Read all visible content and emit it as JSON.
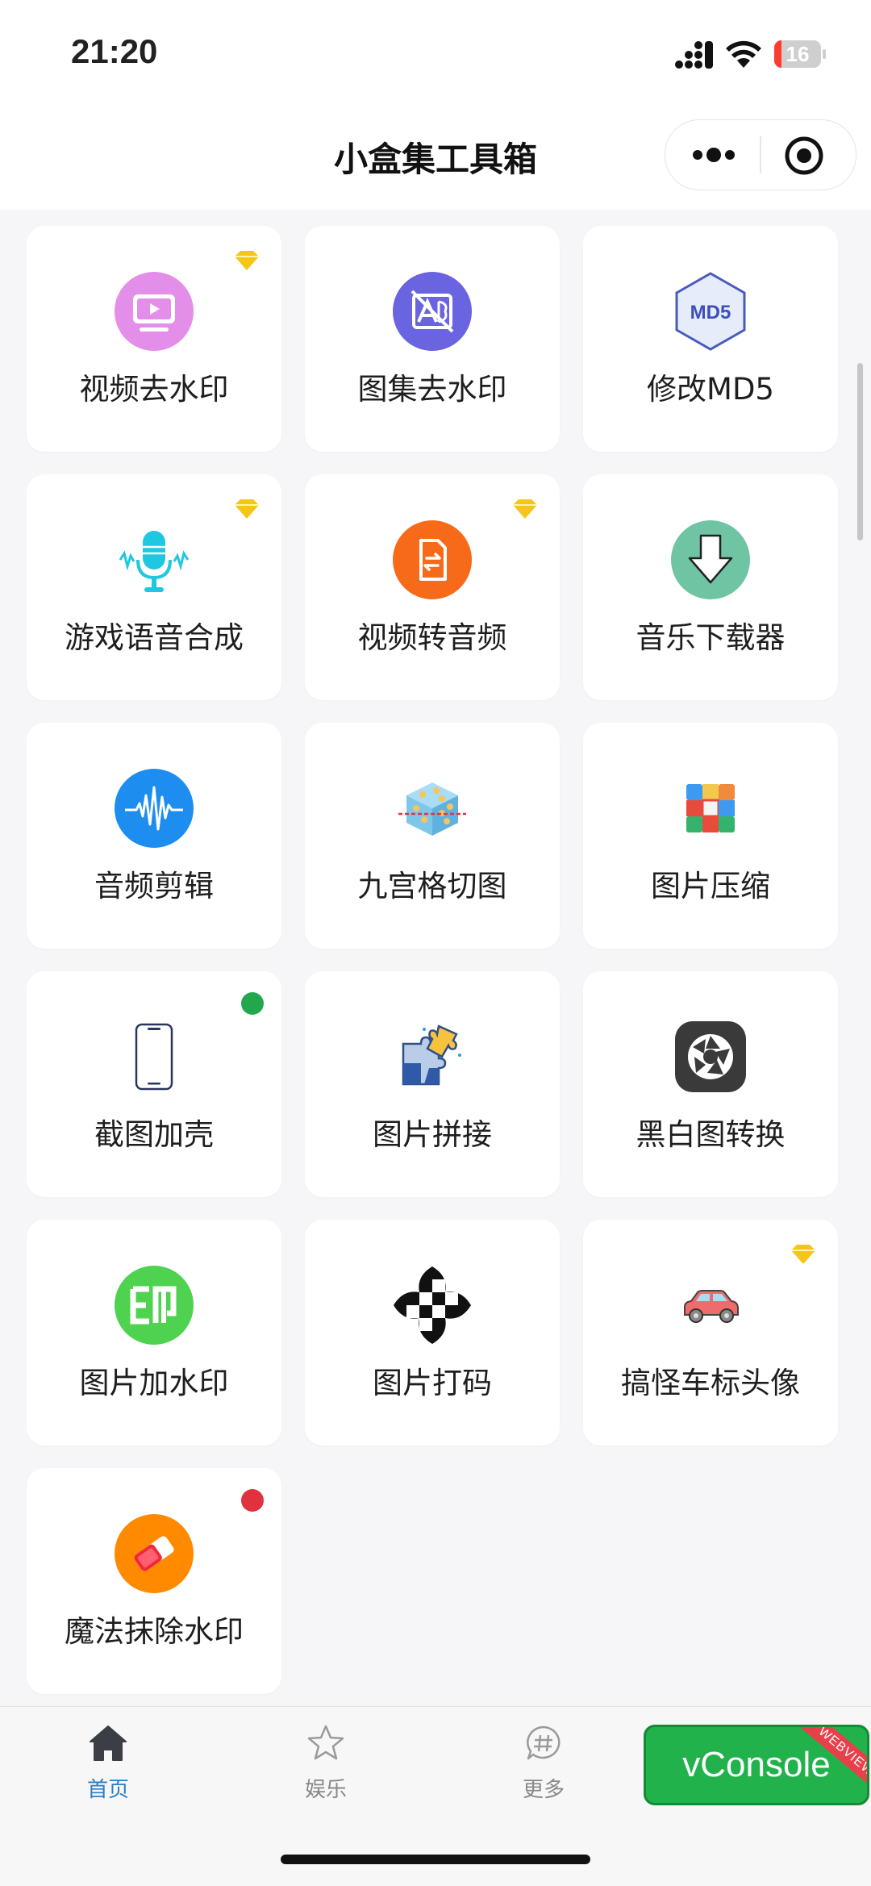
{
  "status_bar": {
    "time": "21:20",
    "battery": {
      "value": "16",
      "level": 0.16,
      "color": "#ff3b30"
    }
  },
  "nav": {
    "title": "小盒集工具箱"
  },
  "tools": [
    {
      "label": "视频去水印",
      "icon": "tv-icon",
      "badge": "diamond"
    },
    {
      "label": "图集去水印",
      "icon": "photo-no-watermark-icon",
      "badge": ""
    },
    {
      "label": "修改MD5",
      "icon": "md5-hexagon-icon",
      "icon_text": "MD5",
      "badge": ""
    },
    {
      "label": "游戏语音合成",
      "icon": "microphone-icon",
      "badge": "diamond"
    },
    {
      "label": "视频转音频",
      "icon": "file-convert-icon",
      "badge": "diamond"
    },
    {
      "label": "音乐下载器",
      "icon": "download-arrow-icon",
      "badge": ""
    },
    {
      "label": "音频剪辑",
      "icon": "audio-wave-icon",
      "badge": ""
    },
    {
      "label": "九宫格切图",
      "icon": "grid-cut-cube-icon",
      "badge": ""
    },
    {
      "label": "图片压缩",
      "icon": "colored-grid-icon",
      "badge": ""
    },
    {
      "label": "截图加壳",
      "icon": "phone-frame-icon",
      "badge": "green-dot"
    },
    {
      "label": "图片拼接",
      "icon": "puzzle-icon",
      "badge": ""
    },
    {
      "label": "黑白图转换",
      "icon": "aperture-icon",
      "badge": ""
    },
    {
      "label": "图片加水印",
      "icon": "stamp-icon",
      "icon_text": "印",
      "badge": ""
    },
    {
      "label": "图片打码",
      "icon": "mosaic-icon",
      "badge": ""
    },
    {
      "label": "搞怪车标头像",
      "icon": "car-icon",
      "badge": "diamond"
    },
    {
      "label": "魔法抹除水印",
      "icon": "eraser-icon",
      "badge": "red-dot"
    }
  ],
  "tabbar": {
    "items": [
      {
        "label": "首页",
        "icon": "home-icon",
        "active": true
      },
      {
        "label": "娱乐",
        "icon": "star-icon",
        "active": false
      },
      {
        "label": "更多",
        "icon": "hashtag-chat-icon",
        "active": false
      }
    ]
  },
  "vconsole": {
    "label": "vConsole",
    "ribbon": "WEBVIEW"
  },
  "colors": {
    "active_tab": "#2a7fc8",
    "badge_gold": "#f5c518",
    "dot_green": "#20a84a",
    "dot_red": "#e0323c",
    "vconsole_green": "#21b24b"
  }
}
